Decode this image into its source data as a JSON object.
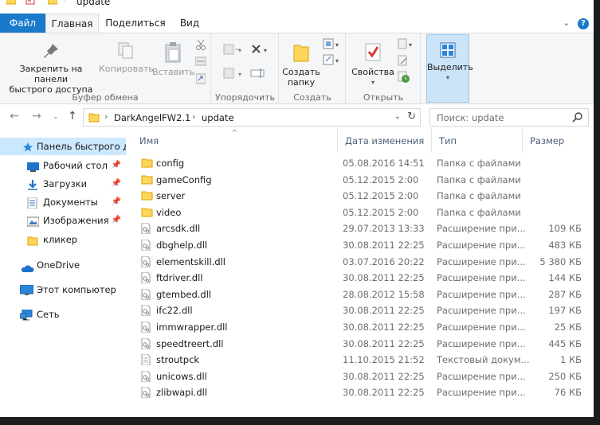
{
  "window": {
    "title": "update"
  },
  "tabs": {
    "file": "Файл",
    "home": "Главная",
    "share": "Поделиться",
    "view": "Вид"
  },
  "ribbon": {
    "clipboard": {
      "pin_label_1": "Закрепить на панели",
      "pin_label_2": "быстрого доступа",
      "copy": "Копировать",
      "paste": "Вставить",
      "group": "Буфер обмена"
    },
    "organize": {
      "group": "Упорядочить"
    },
    "create": {
      "new_folder_1": "Создать",
      "new_folder_2": "папку",
      "group": "Создать"
    },
    "open": {
      "properties": "Свойства",
      "group": "Открыть"
    },
    "select": {
      "label": "Выделить"
    }
  },
  "address": {
    "crumbs": [
      "DarkAngelFW2.1",
      "update"
    ]
  },
  "search": {
    "placeholder": "Поиск: update"
  },
  "nav": {
    "quick_access": "Панель быстрого доступа",
    "items": [
      {
        "label": "Рабочий стол",
        "icon": "desktop-icon",
        "pinned": true
      },
      {
        "label": "Загрузки",
        "icon": "download-icon",
        "pinned": true
      },
      {
        "label": "Документы",
        "icon": "documents-icon",
        "pinned": true
      },
      {
        "label": "Изображения",
        "icon": "pictures-icon",
        "pinned": true
      },
      {
        "label": "кликер",
        "icon": "folder-icon",
        "pinned": false
      }
    ],
    "onedrive": "OneDrive",
    "this_pc": "Этот компьютер",
    "network": "Сеть"
  },
  "columns": {
    "name": "Имя",
    "date": "Дата изменения",
    "type": "Тип",
    "size": "Размер"
  },
  "files": [
    {
      "name": "config",
      "date": "05.08.2016 14:51",
      "type": "Папка с файлами",
      "size": "",
      "kind": "folder"
    },
    {
      "name": "gameConfig",
      "date": "05.12.2015 2:00",
      "type": "Папка с файлами",
      "size": "",
      "kind": "folder"
    },
    {
      "name": "server",
      "date": "05.12.2015 2:00",
      "type": "Папка с файлами",
      "size": "",
      "kind": "folder"
    },
    {
      "name": "video",
      "date": "05.12.2015 2:00",
      "type": "Папка с файлами",
      "size": "",
      "kind": "folder"
    },
    {
      "name": "arcsdk.dll",
      "date": "29.07.2013 13:33",
      "type": "Расширение при...",
      "size": "109 КБ",
      "kind": "dll"
    },
    {
      "name": "dbghelp.dll",
      "date": "30.08.2011 22:25",
      "type": "Расширение при...",
      "size": "483 КБ",
      "kind": "dll"
    },
    {
      "name": "elementskill.dll",
      "date": "03.07.2016 20:22",
      "type": "Расширение при...",
      "size": "5 380 КБ",
      "kind": "dll"
    },
    {
      "name": "ftdriver.dll",
      "date": "30.08.2011 22:25",
      "type": "Расширение при...",
      "size": "144 КБ",
      "kind": "dll"
    },
    {
      "name": "gtembed.dll",
      "date": "28.08.2012 15:58",
      "type": "Расширение при...",
      "size": "287 КБ",
      "kind": "dll"
    },
    {
      "name": "ifc22.dll",
      "date": "30.08.2011 22:25",
      "type": "Расширение при...",
      "size": "197 КБ",
      "kind": "dll"
    },
    {
      "name": "immwrapper.dll",
      "date": "30.08.2011 22:25",
      "type": "Расширение при...",
      "size": "25 КБ",
      "kind": "dll"
    },
    {
      "name": "speedtreert.dll",
      "date": "30.08.2011 22:25",
      "type": "Расширение при...",
      "size": "445 КБ",
      "kind": "dll"
    },
    {
      "name": "stroutpck",
      "date": "11.10.2015 21:52",
      "type": "Текстовый докум...",
      "size": "1 КБ",
      "kind": "text"
    },
    {
      "name": "unicows.dll",
      "date": "30.08.2011 22:25",
      "type": "Расширение при...",
      "size": "250 КБ",
      "kind": "dll"
    },
    {
      "name": "zlibwapi.dll",
      "date": "30.08.2011 22:25",
      "type": "Расширение при...",
      "size": "76 КБ",
      "kind": "dll"
    }
  ],
  "colors": {
    "accent": "#1979ca",
    "selection": "#cce8ff",
    "folder": "#ffd65c"
  }
}
